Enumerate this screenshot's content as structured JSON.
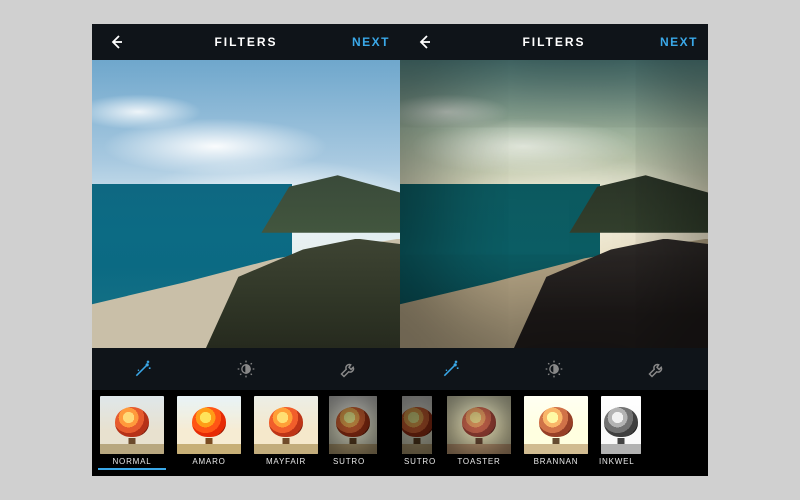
{
  "colors": {
    "accent": "#3aa8e8",
    "bg_dark": "#0f1419"
  },
  "header": {
    "title": "FILTERS",
    "next_label": "NEXT",
    "back_icon": "arrow-left"
  },
  "tools": {
    "items": [
      {
        "name": "magic-wand-icon",
        "active": true
      },
      {
        "name": "brightness-icon",
        "active": false
      },
      {
        "name": "wrench-icon",
        "active": false
      }
    ]
  },
  "phones": {
    "left": {
      "filters": [
        {
          "label": "NORMAL",
          "key": "normal",
          "selected": true
        },
        {
          "label": "AMARO",
          "key": "amaro",
          "selected": false
        },
        {
          "label": "MAYFAIR",
          "key": "mayfair",
          "selected": false
        },
        {
          "label": "SUTRO",
          "key": "sutro",
          "selected": false,
          "cut": true
        }
      ]
    },
    "right": {
      "filters": [
        {
          "label": "SUTRO",
          "key": "sutro",
          "selected": false,
          "cut": true
        },
        {
          "label": "TOASTER",
          "key": "toaster",
          "selected": false
        },
        {
          "label": "BRANNAN",
          "key": "brannan",
          "selected": false
        },
        {
          "label": "INKWELL",
          "key": "inkwell",
          "selected": false,
          "cut": true
        }
      ]
    }
  }
}
